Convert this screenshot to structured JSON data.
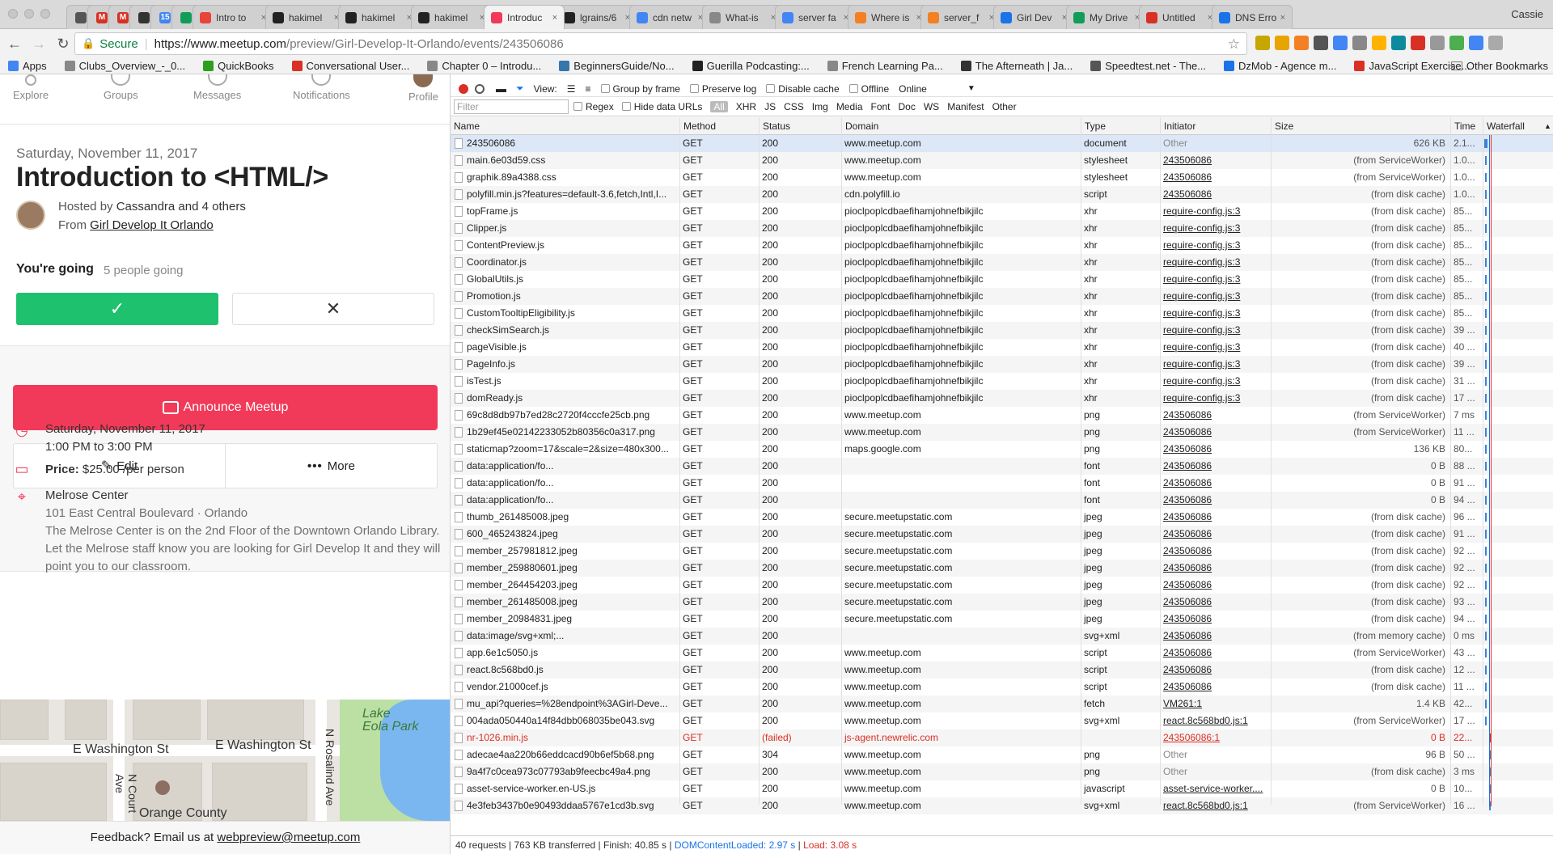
{
  "browser": {
    "tabs": [
      {
        "title": "",
        "favicon_color": "#555555",
        "pinned": true
      },
      {
        "title": "",
        "favicon_color": "#d93025",
        "favicon_glyph": "M",
        "pinned": true
      },
      {
        "title": "",
        "favicon_color": "#d93025",
        "favicon_glyph": "M",
        "pinned": true
      },
      {
        "title": "",
        "favicon_color": "#333333",
        "pinned": true
      },
      {
        "title": "",
        "favicon_color": "#4285f4",
        "favicon_glyph": "15",
        "pinned": true
      },
      {
        "title": "",
        "favicon_color": "#0f9d58",
        "pinned": true
      },
      {
        "title": "Intro to",
        "favicon_color": "#e8443a"
      },
      {
        "title": "hakimel",
        "favicon_color": "#222222"
      },
      {
        "title": "hakimel",
        "favicon_color": "#222222"
      },
      {
        "title": "hakimel",
        "favicon_color": "#222222"
      },
      {
        "title": "Introduc",
        "favicon_color": "#f13a59",
        "active": true
      },
      {
        "title": "lgrains/6",
        "favicon_color": "#222222"
      },
      {
        "title": "cdn netw",
        "favicon_color": "#4285f4"
      },
      {
        "title": "What-is",
        "favicon_color": "#888888"
      },
      {
        "title": "server fa",
        "favicon_color": "#4285f4"
      },
      {
        "title": "Where is",
        "favicon_color": "#f48024"
      },
      {
        "title": "server_f",
        "favicon_color": "#f48024"
      },
      {
        "title": "Girl Dev",
        "favicon_color": "#1a73e8"
      },
      {
        "title": "My Drive",
        "favicon_color": "#0f9d58"
      },
      {
        "title": "Untitled",
        "favicon_color": "#d93025"
      },
      {
        "title": "DNS Erro",
        "favicon_color": "#1a73e8"
      }
    ],
    "user": "Cassie",
    "url_secure": "Secure",
    "url_host": "https://www.meetup.com",
    "url_path": "/preview/Girl-Develop-It-Orlando/events/243506086",
    "bookmarks": [
      {
        "label": "Apps",
        "color": "#4285f4"
      },
      {
        "label": "Clubs_Overview_-_0...",
        "color": "#888888"
      },
      {
        "label": "QuickBooks",
        "color": "#2ca01c"
      },
      {
        "label": "Conversational User...",
        "color": "#d93025"
      },
      {
        "label": "Chapter 0 – Introdu...",
        "color": "#888888"
      },
      {
        "label": "BeginnersGuide/No...",
        "color": "#3776ab"
      },
      {
        "label": "Guerilla Podcasting:...",
        "color": "#222222"
      },
      {
        "label": "French Learning Pa...",
        "color": "#888888"
      },
      {
        "label": "The Afterneath | Ja...",
        "color": "#333333"
      },
      {
        "label": "Speedtest.net - The...",
        "color": "#555555"
      },
      {
        "label": "DzMob - Agence m...",
        "color": "#1a73e8"
      },
      {
        "label": "JavaScript Exercise...",
        "color": "#d93025"
      }
    ],
    "bookmarks_more": "»",
    "other_bookmarks": "Other Bookmarks"
  },
  "meetup": {
    "nav": [
      "Explore",
      "Groups",
      "Messages",
      "Notifications",
      "Profile"
    ],
    "date": "Saturday, November 11, 2017",
    "title": "Introduction to <HTML/>",
    "hosted_prefix": "Hosted by",
    "hosted_by": "Cassandra and 4 others",
    "from_prefix": "From",
    "group": "Girl Develop It Orlando",
    "rsvp_status": "You're going",
    "going_count": "5 people going",
    "yes_icon": "✓",
    "no_icon": "✕",
    "announce": "Announce Meetup",
    "edit": "Edit",
    "more": "More",
    "when_date": "Saturday, November 11, 2017",
    "when_time": "1:00 PM to 3:00 PM",
    "price_label": "Price:",
    "price_value": "$25.00 /per person",
    "venue_name": "Melrose Center",
    "venue_address": "101 East Central Boulevard · Orlando",
    "venue_note": "The Melrose Center is on the 2nd Floor of the Downtown Orlando Library. Let the Melrose staff know you are looking for Girl Develop It and they will point you to our classroom.",
    "map_labels": {
      "lake": "Lake\nEola Park",
      "street1": "E Washington St",
      "street2": "E Washington St",
      "court": "N Court Ave",
      "rosalind": "N Rosalind Ave",
      "county": "Orange County"
    },
    "feedback_prefix": "Feedback? Email us at",
    "feedback_email": "webpreview@meetup.com"
  },
  "devtools": {
    "toolbar": {
      "view": "View:",
      "group_by_frame": "Group by frame",
      "preserve_log": "Preserve log",
      "disable_cache": "Disable cache",
      "offline": "Offline",
      "throttle": "Online"
    },
    "filter_placeholder": "Filter",
    "regex": "Regex",
    "hide_data_urls": "Hide data URLs",
    "filter_types": [
      "All",
      "XHR",
      "JS",
      "CSS",
      "Img",
      "Media",
      "Font",
      "Doc",
      "WS",
      "Manifest",
      "Other"
    ],
    "columns": [
      "Name",
      "Method",
      "Status",
      "Domain",
      "Type",
      "Initiator",
      "Size",
      "Time",
      "Waterfall"
    ],
    "rows": [
      [
        "243506086",
        "GET",
        "200",
        "www.meetup.com",
        "document",
        "Other",
        "626 KB",
        "2.1..."
      ],
      [
        "main.6e03d59.css",
        "GET",
        "200",
        "www.meetup.com",
        "stylesheet",
        "243506086",
        "(from ServiceWorker)",
        "1.0..."
      ],
      [
        "graphik.89a4388.css",
        "GET",
        "200",
        "www.meetup.com",
        "stylesheet",
        "243506086",
        "(from ServiceWorker)",
        "1.0..."
      ],
      [
        "polyfill.min.js?features=default-3.6,fetch,Intl,I...",
        "GET",
        "200",
        "cdn.polyfill.io",
        "script",
        "243506086",
        "(from disk cache)",
        "1.0..."
      ],
      [
        "topFrame.js",
        "GET",
        "200",
        "pioclpoplcdbaefihamjohnefbikjilc",
        "xhr",
        "require-config.js:3",
        "(from disk cache)",
        "85..."
      ],
      [
        "Clipper.js",
        "GET",
        "200",
        "pioclpoplcdbaefihamjohnefbikjilc",
        "xhr",
        "require-config.js:3",
        "(from disk cache)",
        "85..."
      ],
      [
        "ContentPreview.js",
        "GET",
        "200",
        "pioclpoplcdbaefihamjohnefbikjilc",
        "xhr",
        "require-config.js:3",
        "(from disk cache)",
        "85..."
      ],
      [
        "Coordinator.js",
        "GET",
        "200",
        "pioclpoplcdbaefihamjohnefbikjilc",
        "xhr",
        "require-config.js:3",
        "(from disk cache)",
        "85..."
      ],
      [
        "GlobalUtils.js",
        "GET",
        "200",
        "pioclpoplcdbaefihamjohnefbikjilc",
        "xhr",
        "require-config.js:3",
        "(from disk cache)",
        "85..."
      ],
      [
        "Promotion.js",
        "GET",
        "200",
        "pioclpoplcdbaefihamjohnefbikjilc",
        "xhr",
        "require-config.js:3",
        "(from disk cache)",
        "85..."
      ],
      [
        "CustomTooltipEligibility.js",
        "GET",
        "200",
        "pioclpoplcdbaefihamjohnefbikjilc",
        "xhr",
        "require-config.js:3",
        "(from disk cache)",
        "85..."
      ],
      [
        "checkSimSearch.js",
        "GET",
        "200",
        "pioclpoplcdbaefihamjohnefbikjilc",
        "xhr",
        "require-config.js:3",
        "(from disk cache)",
        "39 ..."
      ],
      [
        "pageVisible.js",
        "GET",
        "200",
        "pioclpoplcdbaefihamjohnefbikjilc",
        "xhr",
        "require-config.js:3",
        "(from disk cache)",
        "40 ..."
      ],
      [
        "PageInfo.js",
        "GET",
        "200",
        "pioclpoplcdbaefihamjohnefbikjilc",
        "xhr",
        "require-config.js:3",
        "(from disk cache)",
        "39 ..."
      ],
      [
        "isTest.js",
        "GET",
        "200",
        "pioclpoplcdbaefihamjohnefbikjilc",
        "xhr",
        "require-config.js:3",
        "(from disk cache)",
        "31 ..."
      ],
      [
        "domReady.js",
        "GET",
        "200",
        "pioclpoplcdbaefihamjohnefbikjilc",
        "xhr",
        "require-config.js:3",
        "(from disk cache)",
        "17 ..."
      ],
      [
        "69c8d8db97b7ed28c2720f4cccfe25cb.png",
        "GET",
        "200",
        "www.meetup.com",
        "png",
        "243506086",
        "(from ServiceWorker)",
        "7 ms"
      ],
      [
        "1b29ef45e02142233052b80356c0a317.png",
        "GET",
        "200",
        "www.meetup.com",
        "png",
        "243506086",
        "(from ServiceWorker)",
        "11 ..."
      ],
      [
        "staticmap?zoom=17&scale=2&size=480x300...",
        "GET",
        "200",
        "maps.google.com",
        "png",
        "243506086",
        "136 KB",
        "80..."
      ],
      [
        "data:application/fo...",
        "GET",
        "200",
        "",
        "font",
        "243506086",
        "0 B",
        "88 ..."
      ],
      [
        "data:application/fo...",
        "GET",
        "200",
        "",
        "font",
        "243506086",
        "0 B",
        "91 ..."
      ],
      [
        "data:application/fo...",
        "GET",
        "200",
        "",
        "font",
        "243506086",
        "0 B",
        "94 ..."
      ],
      [
        "thumb_261485008.jpeg",
        "GET",
        "200",
        "secure.meetupstatic.com",
        "jpeg",
        "243506086",
        "(from disk cache)",
        "96 ..."
      ],
      [
        "600_465243824.jpeg",
        "GET",
        "200",
        "secure.meetupstatic.com",
        "jpeg",
        "243506086",
        "(from disk cache)",
        "91 ..."
      ],
      [
        "member_257981812.jpeg",
        "GET",
        "200",
        "secure.meetupstatic.com",
        "jpeg",
        "243506086",
        "(from disk cache)",
        "92 ..."
      ],
      [
        "member_259880601.jpeg",
        "GET",
        "200",
        "secure.meetupstatic.com",
        "jpeg",
        "243506086",
        "(from disk cache)",
        "92 ..."
      ],
      [
        "member_264454203.jpeg",
        "GET",
        "200",
        "secure.meetupstatic.com",
        "jpeg",
        "243506086",
        "(from disk cache)",
        "92 ..."
      ],
      [
        "member_261485008.jpeg",
        "GET",
        "200",
        "secure.meetupstatic.com",
        "jpeg",
        "243506086",
        "(from disk cache)",
        "93 ..."
      ],
      [
        "member_20984831.jpeg",
        "GET",
        "200",
        "secure.meetupstatic.com",
        "jpeg",
        "243506086",
        "(from disk cache)",
        "94 ..."
      ],
      [
        "data:image/svg+xml;...",
        "GET",
        "200",
        "",
        "svg+xml",
        "243506086",
        "(from memory cache)",
        "0 ms"
      ],
      [
        "app.6e1c5050.js",
        "GET",
        "200",
        "www.meetup.com",
        "script",
        "243506086",
        "(from ServiceWorker)",
        "43 ..."
      ],
      [
        "react.8c568bd0.js",
        "GET",
        "200",
        "www.meetup.com",
        "script",
        "243506086",
        "(from disk cache)",
        "12 ..."
      ],
      [
        "vendor.21000cef.js",
        "GET",
        "200",
        "www.meetup.com",
        "script",
        "243506086",
        "(from disk cache)",
        "11 ..."
      ],
      [
        "mu_api?queries=%28endpoint%3AGirl-Deve...",
        "GET",
        "200",
        "www.meetup.com",
        "fetch",
        "VM261:1",
        "1.4 KB",
        "42..."
      ],
      [
        "004ada050440a14f84dbb068035be043.svg",
        "GET",
        "200",
        "www.meetup.com",
        "svg+xml",
        "react.8c568bd0.js:1",
        "(from ServiceWorker)",
        "17 ..."
      ],
      [
        "nr-1026.min.js",
        "GET",
        "(failed)",
        "js-agent.newrelic.com",
        "",
        "243506086:1",
        "0 B",
        "22..."
      ],
      [
        "adecae4aa220b66eddcacd90b6ef5b68.png",
        "GET",
        "304",
        "www.meetup.com",
        "png",
        "Other",
        "96 B",
        "50 ..."
      ],
      [
        "9a4f7c0cea973c07793ab9feecbc49a4.png",
        "GET",
        "200",
        "www.meetup.com",
        "png",
        "Other",
        "(from disk cache)",
        "3 ms"
      ],
      [
        "asset-service-worker.en-US.js",
        "GET",
        "200",
        "www.meetup.com",
        "javascript",
        "asset-service-worker....",
        "0 B",
        "10..."
      ],
      [
        "4e3feb3437b0e90493ddaa5767e1cd3b.svg",
        "GET",
        "200",
        "www.meetup.com",
        "svg+xml",
        "react.8c568bd0.js:1",
        "(from ServiceWorker)",
        "16 ..."
      ]
    ],
    "status_summary": "40 requests | 763 KB transferred | Finish: 40.85 s |",
    "dom_loaded": "DOMContentLoaded: 2.97 s",
    "load": "Load: 3.08 s"
  }
}
